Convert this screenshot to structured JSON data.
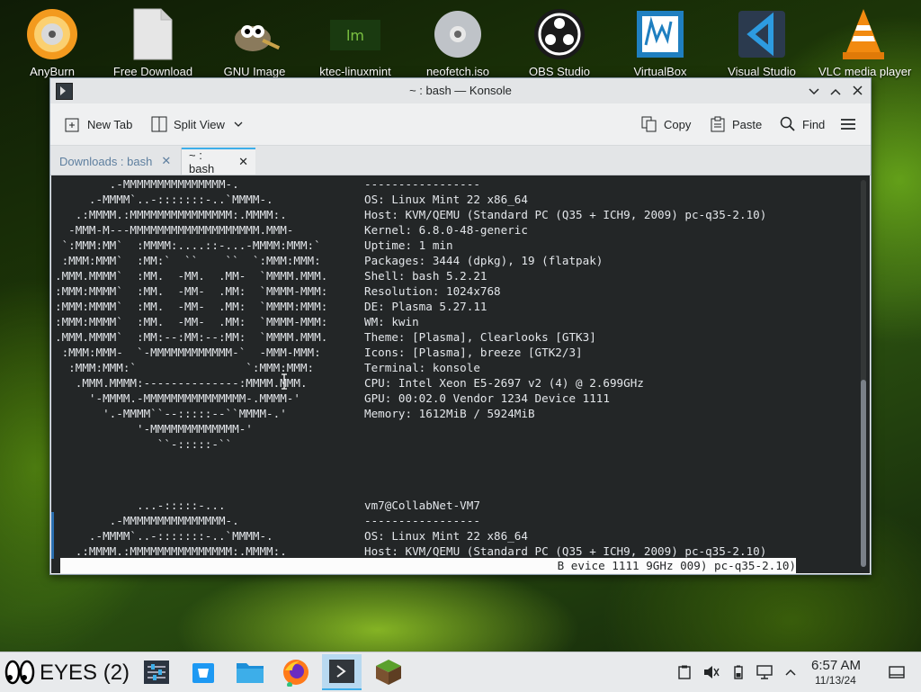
{
  "desktop": {
    "icons": [
      {
        "name": "anyburn-icon",
        "label": "AnyBurn"
      },
      {
        "name": "document-icon",
        "label": "Free Download"
      },
      {
        "name": "gimp-icon",
        "label": "GNU Image"
      },
      {
        "name": "mint-folder-icon",
        "label": "ktec-linuxmint"
      },
      {
        "name": "disc-image-icon",
        "label": "neofetch.iso"
      },
      {
        "name": "obs-icon",
        "label": "OBS Studio"
      },
      {
        "name": "virtualbox-icon",
        "label": "VirtualBox"
      },
      {
        "name": "vscode-icon",
        "label": "Visual Studio"
      },
      {
        "name": "vlc-icon",
        "label": "VLC media player"
      }
    ]
  },
  "window": {
    "title": "~ : bash — Konsole",
    "toolbar": {
      "new_tab": "New Tab",
      "split_view": "Split View",
      "copy": "Copy",
      "paste": "Paste",
      "find": "Find"
    },
    "tabs": [
      {
        "label": "Downloads : bash",
        "active": false
      },
      {
        "label": "~ : bash",
        "active": true
      }
    ]
  },
  "terminal": {
    "lines": [
      {
        "art": "        .-MMMMMMMMMMMMMMM-.",
        "info": "-----------------"
      },
      {
        "art": "     .-MMMM`..-:::::::-..`MMMM-.",
        "info": "OS: Linux Mint 22 x86_64"
      },
      {
        "art": "   .:MMMM.:MMMMMMMMMMMMMMM:.MMMM:.",
        "info": "Host: KVM/QEMU (Standard PC (Q35 + ICH9, 2009) pc-q35-2.10)"
      },
      {
        "art": "  -MMM-M---MMMMMMMMMMMMMMMMMMM.MMM-",
        "info": "Kernel: 6.8.0-48-generic"
      },
      {
        "art": " `:MMM:MM`  :MMMM:....::-...-MMMM:MMM:`",
        "info": "Uptime: 1 min"
      },
      {
        "art": " :MMM:MMM`  :MM:`  ``    ``  `:MMM:MMM:",
        "info": "Packages: 3444 (dpkg), 19 (flatpak)"
      },
      {
        "art": ".MMM.MMMM`  :MM.  -MM.  .MM-  `MMMM.MMM.",
        "info": "Shell: bash 5.2.21"
      },
      {
        "art": ":MMM:MMMM`  :MM.  -MM-  .MM:  `MMMM-MMM:",
        "info": "Resolution: 1024x768"
      },
      {
        "art": ":MMM:MMMM`  :MM.  -MM-  .MM:  `MMMM:MMM:",
        "info": "DE: Plasma 5.27.11"
      },
      {
        "art": ":MMM:MMMM`  :MM.  -MM-  .MM:  `MMMM-MMM:",
        "info": "WM: kwin"
      },
      {
        "art": ".MMM.MMMM`  :MM:--:MM:--:MM:  `MMMM.MMM.",
        "info": "Theme: [Plasma], Clearlooks [GTK3]"
      },
      {
        "art": " :MMM:MMM-  `-MMMMMMMMMMMM-`  -MMM-MMM:",
        "info": "Icons: [Plasma], breeze [GTK2/3]"
      },
      {
        "art": "  :MMM:MMM:`                `:MMM:MMM:",
        "info": "Terminal: konsole"
      },
      {
        "art": "   .MMM.MMMM:--------------:MMMM.MMM.",
        "info": "CPU: Intel Xeon E5-2697 v2 (4) @ 2.699GHz"
      },
      {
        "art": "     '-MMMM.-MMMMMMMMMMMMMMM-.MMMM-'",
        "info": "GPU: 00:02.0 Vendor 1234 Device 1111"
      },
      {
        "art": "       '.-MMMM``--:::::--``MMMM-.'",
        "info": "Memory: 1612MiB / 5924MiB"
      },
      {
        "art": "            '-MMMMMMMMMMMMM-'",
        "info": ""
      },
      {
        "art": "               ``-:::::-``",
        "info": ""
      },
      {
        "art": "",
        "info": ""
      },
      {
        "art": "",
        "info": ""
      },
      {
        "art": "",
        "info": ""
      },
      {
        "art": "            ...-:::::-...",
        "info": "vm7@CollabNet-VM7"
      },
      {
        "art": "        .-MMMMMMMMMMMMMMM-.",
        "info": "-----------------"
      },
      {
        "art": "     .-MMMM`..-:::::::-..`MMMM-.",
        "info": "OS: Linux Mint 22 x86_64"
      },
      {
        "art": "   .:MMMM.:MMMMMMMMMMMMMMM:.MMMM:.",
        "info": "Host: KVM/QEMU (Standard PC (Q35 + ICH9, 2009) pc-q35-2.10)"
      }
    ],
    "input_line": "B evice 1111 9GHz 009) pc-q35-2.10)"
  },
  "taskbar": {
    "eyes_label": "EYES (2)",
    "clock_time": "6:57 AM",
    "clock_date": "11/13/24",
    "apps": [
      "mixer-app-icon",
      "discover-icon",
      "dolphin-files-icon",
      "firefox-icon",
      "konsole-icon",
      "minecraft-icon"
    ]
  },
  "colors": {
    "terminal_bg": "#232627",
    "terminal_fg": "#e3e6ea",
    "accent": "#3daee9",
    "inactive_tab_text": "#5e7f9f"
  }
}
